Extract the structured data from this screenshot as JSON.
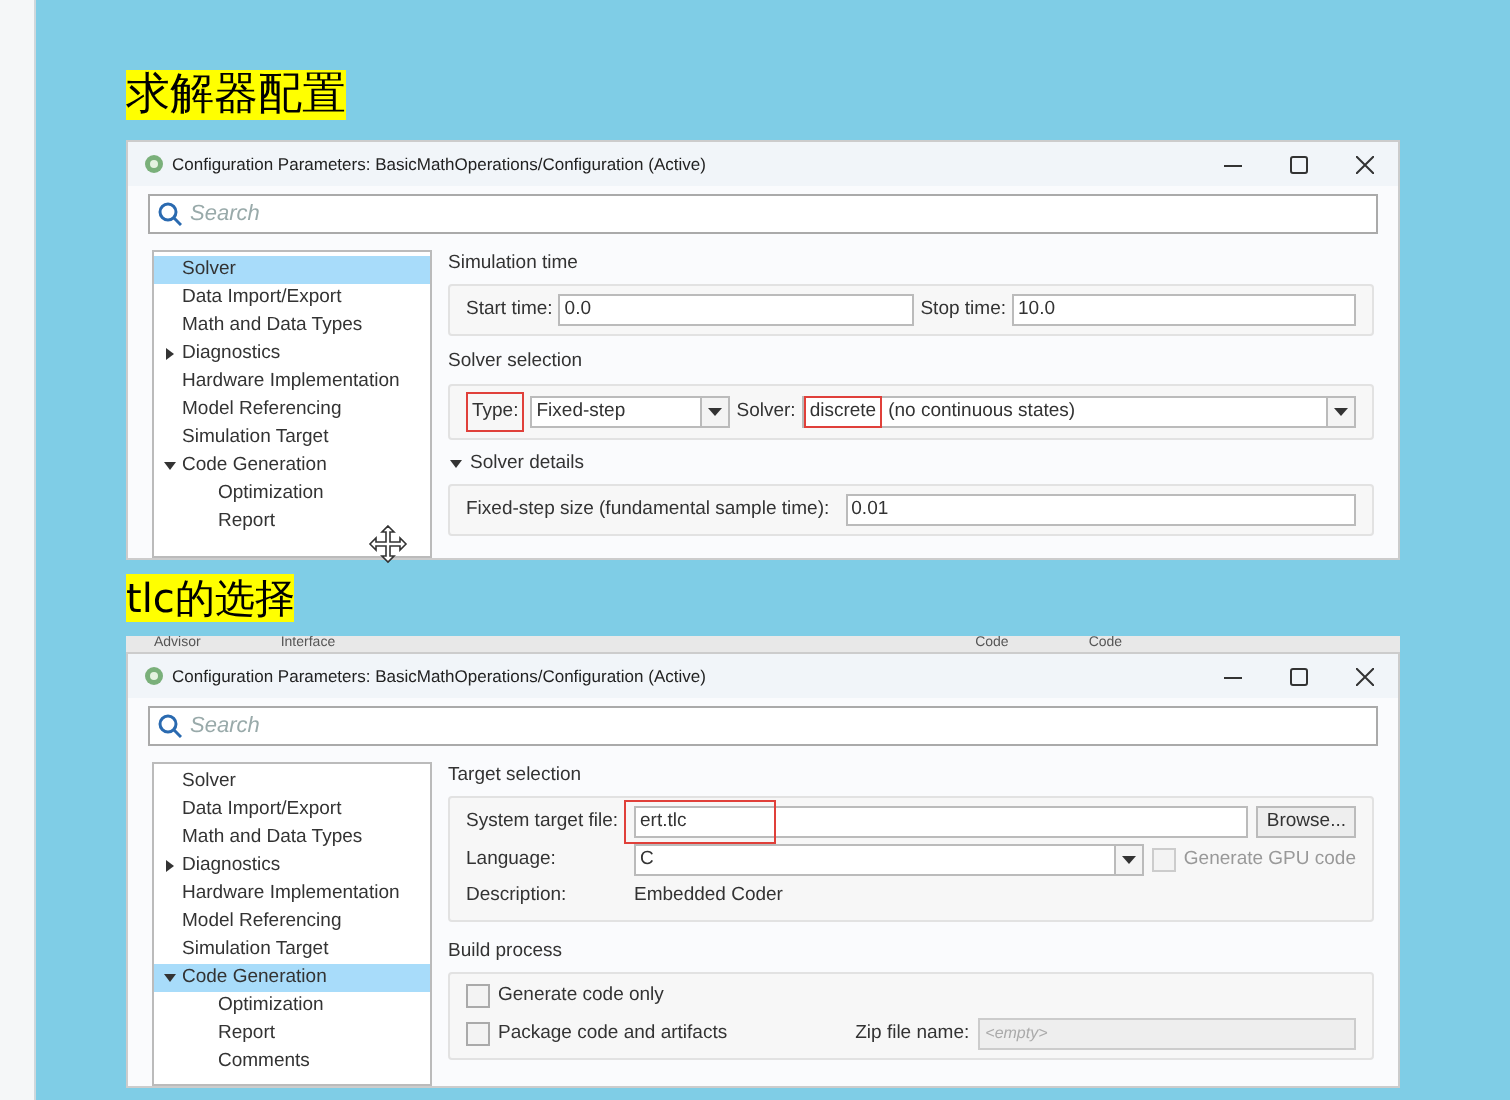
{
  "solver_section": {
    "heading": "求解器配置",
    "window": {
      "title": "Configuration Parameters: BasicMathOperations/Configuration (Active)",
      "search_placeholder": "Search",
      "sidebar": [
        {
          "label": "Solver",
          "selected": true
        },
        {
          "label": "Data Import/Export",
          "selected": false
        },
        {
          "label": "Math and Data Types",
          "selected": false
        },
        {
          "label": "Diagnostics",
          "selected": false,
          "expanded": false
        },
        {
          "label": "Hardware Implementation",
          "selected": false
        },
        {
          "label": "Model Referencing",
          "selected": false
        },
        {
          "label": "Simulation Target",
          "selected": false
        },
        {
          "label": "Code Generation",
          "selected": false,
          "expanded": true,
          "children": [
            {
              "label": "Optimization",
              "selected": false
            },
            {
              "label": "Report",
              "selected": false
            }
          ]
        }
      ],
      "simulation_time": {
        "title": "Simulation time",
        "start_label": "Start time:",
        "start_value": "0.0",
        "stop_label": "Stop time:",
        "stop_value": "10.0"
      },
      "solver_selection": {
        "title": "Solver selection",
        "type_label": "Type:",
        "type_value": "Fixed-step",
        "type_highlighted": true,
        "solver_label": "Solver:",
        "solver_value_highlighted": "discrete",
        "solver_value_rest": "(no continuous states)"
      },
      "solver_details": {
        "title": "Solver details",
        "expanded": true,
        "step_label": "Fixed-step size (fundamental sample time):",
        "step_value": "0.01"
      }
    }
  },
  "tlc_section": {
    "heading": "tlc的选择",
    "toolbar_strip": [
      "Advisor",
      "Interface",
      "Code",
      "Code"
    ],
    "window": {
      "title": "Configuration Parameters: BasicMathOperations/Configuration (Active)",
      "search_placeholder": "Search",
      "sidebar": [
        {
          "label": "Solver",
          "selected": false
        },
        {
          "label": "Data Import/Export",
          "selected": false
        },
        {
          "label": "Math and Data Types",
          "selected": false
        },
        {
          "label": "Diagnostics",
          "selected": false,
          "expanded": false
        },
        {
          "label": "Hardware Implementation",
          "selected": false
        },
        {
          "label": "Model Referencing",
          "selected": false
        },
        {
          "label": "Simulation Target",
          "selected": false
        },
        {
          "label": "Code Generation",
          "selected": true,
          "expanded": true,
          "children": [
            {
              "label": "Optimization",
              "selected": false
            },
            {
              "label": "Report",
              "selected": false
            },
            {
              "label": "Comments",
              "selected": false
            }
          ]
        }
      ],
      "target_selection": {
        "title": "Target selection",
        "target_label": "System target file:",
        "target_value": "ert.tlc",
        "target_highlighted": true,
        "browse": "Browse...",
        "language_label": "Language:",
        "language_value": "C",
        "gpu_label": "Generate GPU code",
        "gpu_checked": false,
        "gpu_disabled": true,
        "description_label": "Description:",
        "description_value": "Embedded Coder"
      },
      "build_process": {
        "title": "Build process",
        "generate_only_label": "Generate code only",
        "generate_only_checked": false,
        "package_label": "Package code and artifacts",
        "package_checked": false,
        "zip_label": "Zip file name:",
        "zip_placeholder": "<empty>"
      }
    }
  }
}
